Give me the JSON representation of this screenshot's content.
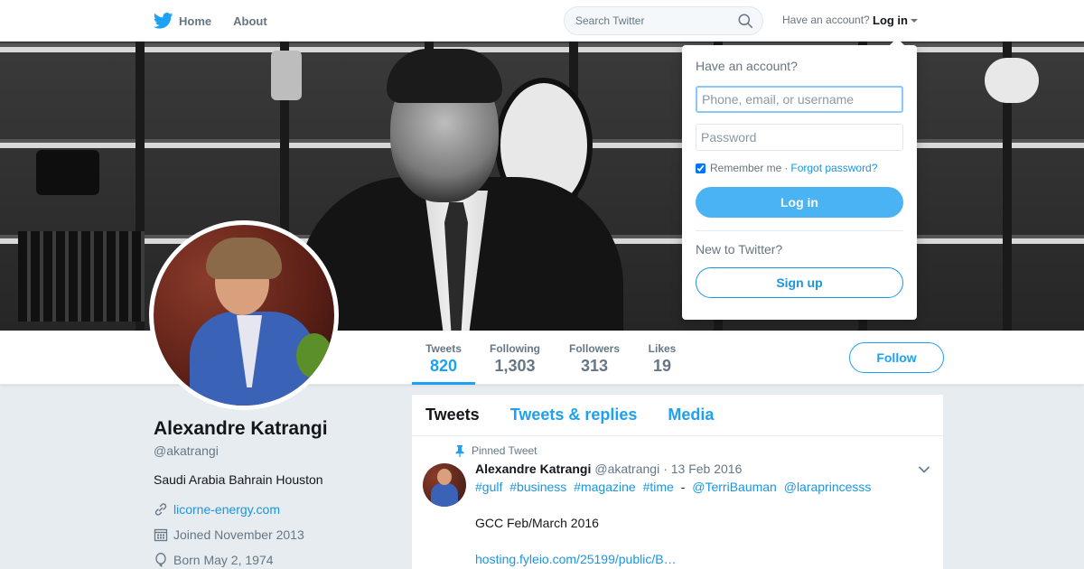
{
  "nav": {
    "home_label": "Home",
    "about_label": "About",
    "search_placeholder": "Search Twitter",
    "account_prompt": "Have an account?",
    "login_label": "Log in"
  },
  "login_dropdown": {
    "heading": "Have an account?",
    "username_placeholder": "Phone, email, or username",
    "password_placeholder": "Password",
    "remember_label": "Remember me",
    "separator": "·",
    "forgot_label": "Forgot password?",
    "login_button": "Log in",
    "new_prompt": "New to Twitter?",
    "signup_button": "Sign up"
  },
  "stats": [
    {
      "label": "Tweets",
      "value": "820",
      "active": true
    },
    {
      "label": "Following",
      "value": "1,303",
      "active": false
    },
    {
      "label": "Followers",
      "value": "313",
      "active": false
    },
    {
      "label": "Likes",
      "value": "19",
      "active": false
    }
  ],
  "follow_button": "Follow",
  "profile": {
    "name": "Alexandre Katrangi",
    "handle": "@akatrangi",
    "bio": "Saudi Arabia Bahrain Houston",
    "url": "licorne-energy.com",
    "joined": "Joined November 2013",
    "born": "Born May 2, 1974"
  },
  "timeline": {
    "tabs": [
      "Tweets",
      "Tweets & replies",
      "Media"
    ],
    "pinned_label": "Pinned Tweet",
    "tweet": {
      "author": "Alexandre Katrangi",
      "handle": "@akatrangi",
      "date": "· 13 Feb 2016",
      "tags": [
        "#gulf",
        "#business",
        "#magazine",
        "#time"
      ],
      "dash": "-",
      "mentions": [
        "@TerriBauman",
        "@laraprincesss"
      ],
      "text": "GCC Feb/March 2016",
      "link": "hosting.fyleio.com/25199/public/B…"
    }
  },
  "colors": {
    "accent": "#1da1f2",
    "link": "#1b95e0",
    "button_fill": "#4ab3f4",
    "background": "#e6ecf0"
  },
  "icons": [
    "twitter-bird-icon",
    "search-icon",
    "caret-down-icon",
    "link-icon",
    "calendar-icon",
    "balloon-icon",
    "pin-icon",
    "chevron-down-icon"
  ]
}
